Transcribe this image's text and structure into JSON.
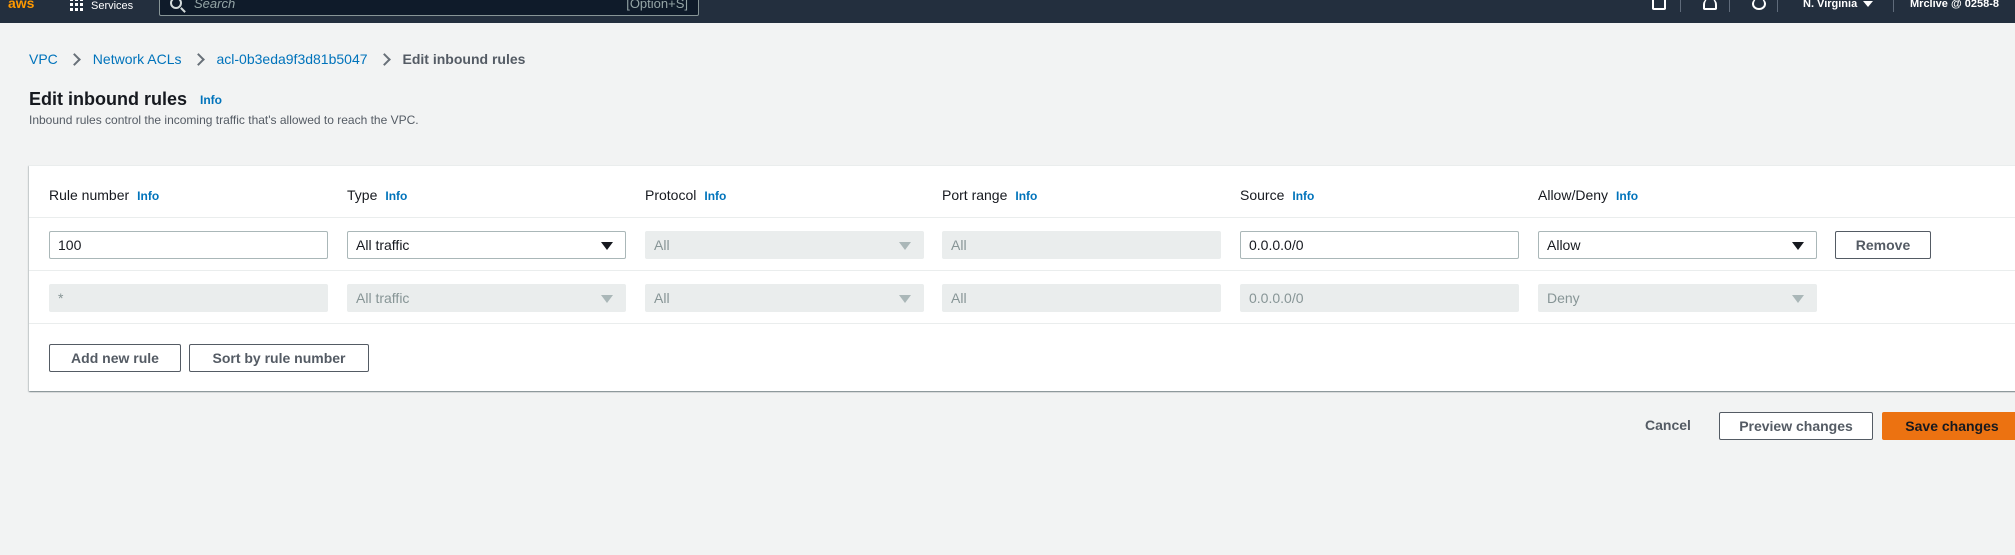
{
  "topbar": {
    "logo_text": "aws",
    "services_label": "Services",
    "search_placeholder": "Search",
    "search_shortcut": "[Option+S]",
    "region": "N. Virginia",
    "user": "Mrclive @ 0258-8"
  },
  "breadcrumb": {
    "items": [
      "VPC",
      "Network ACLs",
      "acl-0b3eda9f3d81b5047"
    ],
    "current": "Edit inbound rules"
  },
  "header": {
    "title": "Edit inbound rules",
    "info": "Info",
    "description": "Inbound rules control the incoming traffic that's allowed to reach the VPC."
  },
  "table": {
    "columns": [
      {
        "label": "Rule number",
        "info": "Info"
      },
      {
        "label": "Type",
        "info": "Info"
      },
      {
        "label": "Protocol",
        "info": "Info"
      },
      {
        "label": "Port range",
        "info": "Info"
      },
      {
        "label": "Source",
        "info": "Info"
      },
      {
        "label": "Allow/Deny",
        "info": "Info"
      }
    ],
    "rows": [
      {
        "rule_number": "100",
        "type": "All traffic",
        "protocol": "All",
        "port_range": "All",
        "source": "0.0.0.0/0",
        "allow_deny": "Allow",
        "remove_label": "Remove"
      },
      {
        "rule_number": "*",
        "type": "All traffic",
        "protocol": "All",
        "port_range": "All",
        "source": "0.0.0.0/0",
        "allow_deny": "Deny"
      }
    ],
    "add_rule_label": "Add new rule",
    "sort_label": "Sort by rule number"
  },
  "footer": {
    "cancel_label": "Cancel",
    "preview_label": "Preview changes",
    "save_label": "Save changes"
  },
  "colors": {
    "topbar_bg": "#232f3e",
    "link": "#0073bb",
    "primary_button": "#ec7211",
    "page_bg": "#f2f3f3"
  }
}
